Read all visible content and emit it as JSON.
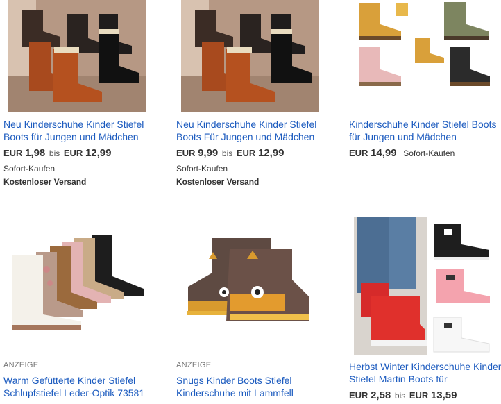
{
  "listings": [
    {
      "title": "Neu Kinderschuhe Kinder Stiefel Boots für Jungen und Mädchen",
      "price_currency": "EUR",
      "price_low": "1,98",
      "price_sep": "bis",
      "price_currency2": "EUR",
      "price_high": "12,99",
      "buy_format": "Sofort-Kaufen",
      "shipping": "Kostenloser Versand",
      "image": "boots-photo-icon"
    },
    {
      "title": "Neu Kinderschuhe Kinder Stiefel Boots Für Jungen und Mädchen",
      "price_currency": "EUR",
      "price_low": "9,99",
      "price_sep": "bis",
      "price_currency2": "EUR",
      "price_high": "12,99",
      "buy_format": "Sofort-Kaufen",
      "shipping": "Kostenloser Versand",
      "image": "boots-photo-icon"
    },
    {
      "title": "Kinderschuhe Kinder Stiefel Boots für Jungen und Mädchen",
      "price_currency": "EUR",
      "price": "14,99",
      "buy_format": "Sofort-Kaufen",
      "image": "work-boots-icon"
    },
    {
      "ad_label": "ANZEIGE",
      "title": "Warm Gefütterte Kinder Stiefel Schlupfstiefel Leder-Optik 73581",
      "image": "snow-boots-icon"
    },
    {
      "ad_label": "ANZEIGE",
      "title": "Snugs Kinder Boots Stiefel Kinderschuhe mit Lammfell",
      "image": "animal-boots-icon"
    },
    {
      "title": "Herbst Winter Kinderschuhe Kinder Stiefel Martin Boots für",
      "price_currency": "EUR",
      "price_low": "2,58",
      "price_sep": "bis",
      "price_currency2": "EUR",
      "price_high": "13,59",
      "image": "sneaker-boots-icon"
    }
  ],
  "colors": {
    "link": "#1c5bbf",
    "divider": "#e5e5e5",
    "text": "#333333"
  }
}
